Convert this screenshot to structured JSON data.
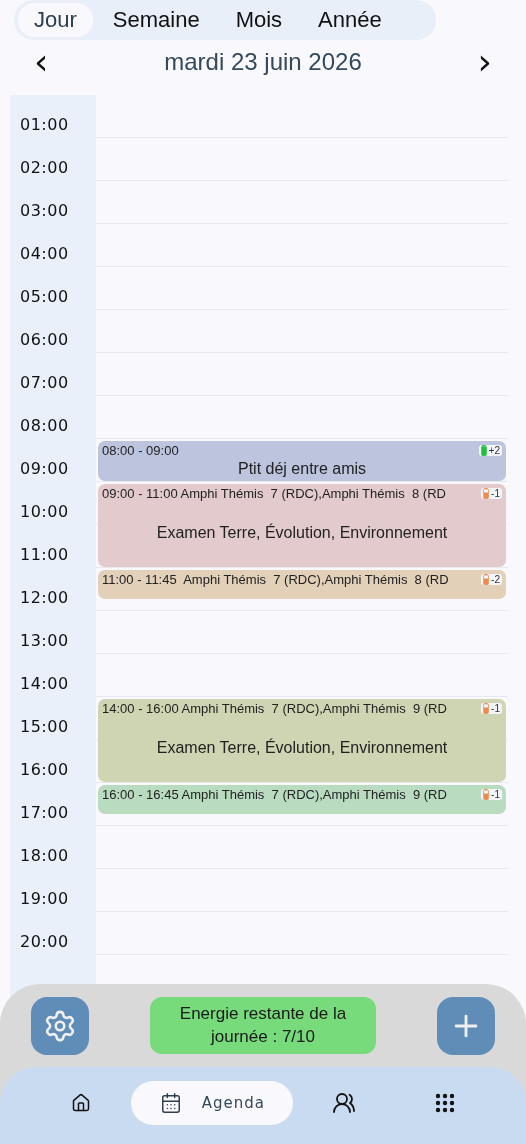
{
  "view_tabs": [
    {
      "label": "Jour",
      "selected": true
    },
    {
      "label": "Semaine",
      "selected": false
    },
    {
      "label": "Mois",
      "selected": false
    },
    {
      "label": "Année",
      "selected": false
    }
  ],
  "date_nav": {
    "prev": "‹",
    "date": "mardi 23 juin 2026",
    "next": "›"
  },
  "hours": [
    "01:00",
    "02:00",
    "03:00",
    "04:00",
    "05:00",
    "06:00",
    "07:00",
    "08:00",
    "09:00",
    "10:00",
    "11:00",
    "12:00",
    "13:00",
    "14:00",
    "15:00",
    "16:00",
    "17:00",
    "18:00",
    "19:00",
    "20:00"
  ],
  "events": [
    {
      "time": "08:00 - 09:00",
      "title": "Ptit déj entre amis",
      "energy": "+2",
      "kind": "gain",
      "color": "#bcc4de"
    },
    {
      "time": "09:00 - 11:00",
      "location": "Amphi Thémis  7 (RDC),Amphi Thémis  8 (RD",
      "title": "Examen Terre, Évolution, Environnement",
      "energy": "-1",
      "kind": "cost",
      "color": "#e3cbcd"
    },
    {
      "time": "11:00 - 11:45",
      "location": " Amphi Thémis  7 (RDC),Amphi Thémis  8 (RD",
      "energy": "-2",
      "kind": "cost",
      "color": "#e2d0b9"
    },
    {
      "time": "14:00 - 16:00",
      "location": "Amphi Thémis  7 (RDC),Amphi Thémis  9 (RD",
      "title": "Examen Terre, Évolution, Environnement",
      "energy": "-1",
      "kind": "cost",
      "color": "#cfd5b3"
    },
    {
      "time": "16:00 - 16:45",
      "location": "Amphi Thémis  7 (RDC),Amphi Thémis  9 (RD",
      "energy": "-1",
      "kind": "cost",
      "color": "#b9dcc1"
    }
  ],
  "energy_banner": "Energie restante de la journée : 7/10",
  "bottom_nav": [
    {
      "kind": "home",
      "selected": false
    },
    {
      "label": "Agenda",
      "kind": "calendar",
      "selected": true
    },
    {
      "kind": "people",
      "selected": false
    },
    {
      "kind": "grid",
      "selected": false
    }
  ]
}
